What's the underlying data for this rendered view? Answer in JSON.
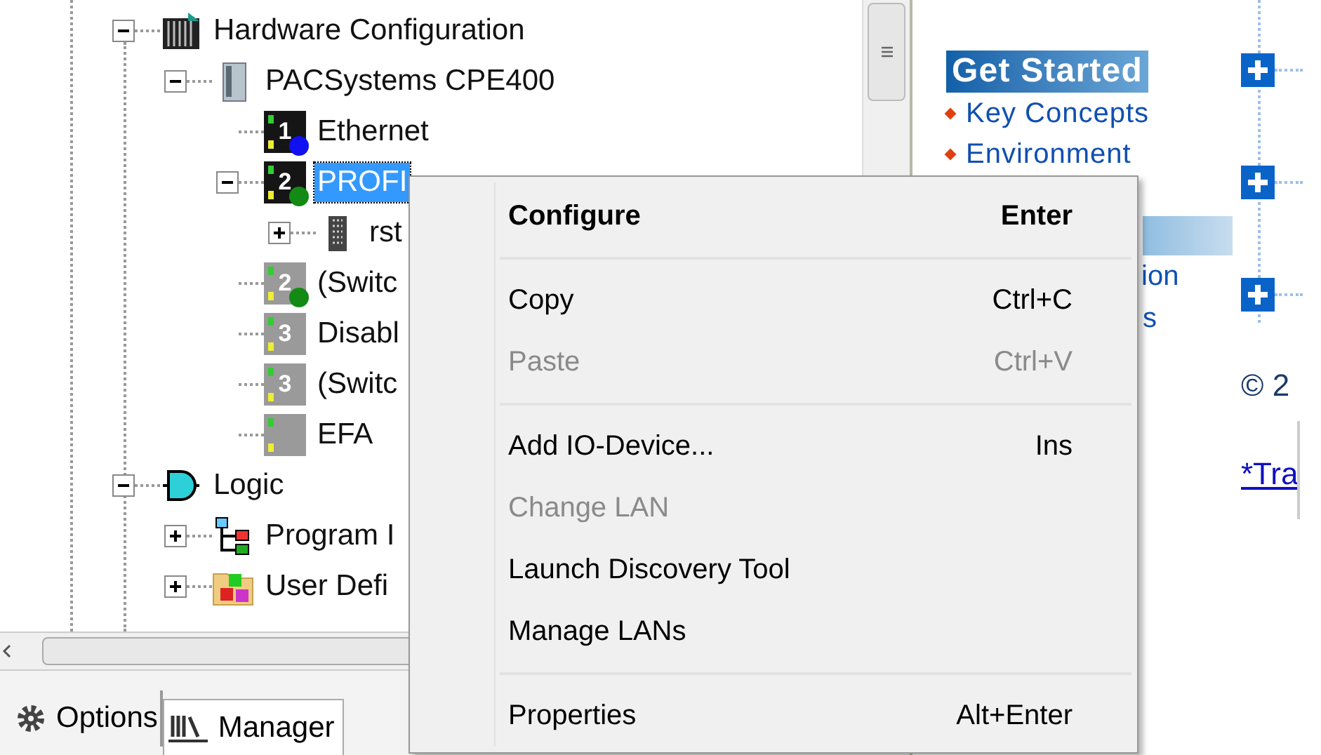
{
  "tree": [
    {
      "label": "Hardware Configuration",
      "kind": "rack",
      "expanded": true,
      "selected": false,
      "children": [
        {
          "label": "PACSystems CPE400",
          "kind": "cpu",
          "expanded": true,
          "selected": false,
          "children": [
            {
              "label": "Ethernet",
              "kind": "port",
              "port": "1",
              "color": "#1010f0",
              "disabled": false,
              "selected": false
            },
            {
              "label": "PROFI",
              "kind": "port",
              "port": "2",
              "color": "#138a13",
              "disabled": false,
              "expanded": true,
              "selected": true,
              "children": [
                {
                  "label": "rst",
                  "kind": "device",
                  "expanded": false,
                  "selected": false
                }
              ]
            },
            {
              "label": "(Switc",
              "kind": "port",
              "port": "2",
              "color": "#138a13",
              "disabled": true,
              "selected": false
            },
            {
              "label": "Disabl",
              "kind": "port",
              "port": "3",
              "disabled": true,
              "selected": false
            },
            {
              "label": "(Switc",
              "kind": "port",
              "port": "3",
              "disabled": true,
              "selected": false
            },
            {
              "label": "EFA",
              "kind": "port",
              "disabled": true,
              "selected": false
            }
          ]
        }
      ]
    },
    {
      "label": "Logic",
      "kind": "gate",
      "expanded": true,
      "selected": false,
      "children": [
        {
          "label": "Program I",
          "kind": "hierarchy",
          "expanded": false,
          "selected": false
        },
        {
          "label": "User Defi",
          "kind": "blocks",
          "expanded": false,
          "selected": false
        }
      ]
    }
  ],
  "tabs": [
    {
      "label": "Options",
      "kind": "gear",
      "selected": false
    },
    {
      "label": "Manager",
      "kind": "books",
      "selected": true
    }
  ],
  "help": {
    "heading": "Get Started",
    "links": [
      "Key Concepts",
      "Environment"
    ],
    "hidden_links": [
      "ion",
      "s"
    ],
    "copyright": "© 2",
    "footnote": "*Tra"
  },
  "context_menu": [
    {
      "kind": "item",
      "label": "Configure",
      "shortcut": "Enter",
      "default": true,
      "disabled": false
    },
    {
      "kind": "separator"
    },
    {
      "kind": "item",
      "label": "Copy",
      "shortcut": "Ctrl+C",
      "default": false,
      "disabled": false
    },
    {
      "kind": "item",
      "label": "Paste",
      "shortcut": "Ctrl+V",
      "default": false,
      "disabled": true
    },
    {
      "kind": "separator"
    },
    {
      "kind": "item",
      "label": "Add IO-Device...",
      "shortcut": "Ins",
      "default": false,
      "disabled": false
    },
    {
      "kind": "item",
      "label": "Change LAN",
      "default": false,
      "disabled": true
    },
    {
      "kind": "item",
      "label": "Launch Discovery Tool",
      "default": false,
      "disabled": false
    },
    {
      "kind": "item",
      "label": "Manage LANs",
      "default": false,
      "disabled": false
    },
    {
      "kind": "separator"
    },
    {
      "kind": "item",
      "label": "Properties",
      "shortcut": "Alt+Enter",
      "default": false,
      "disabled": false
    }
  ]
}
